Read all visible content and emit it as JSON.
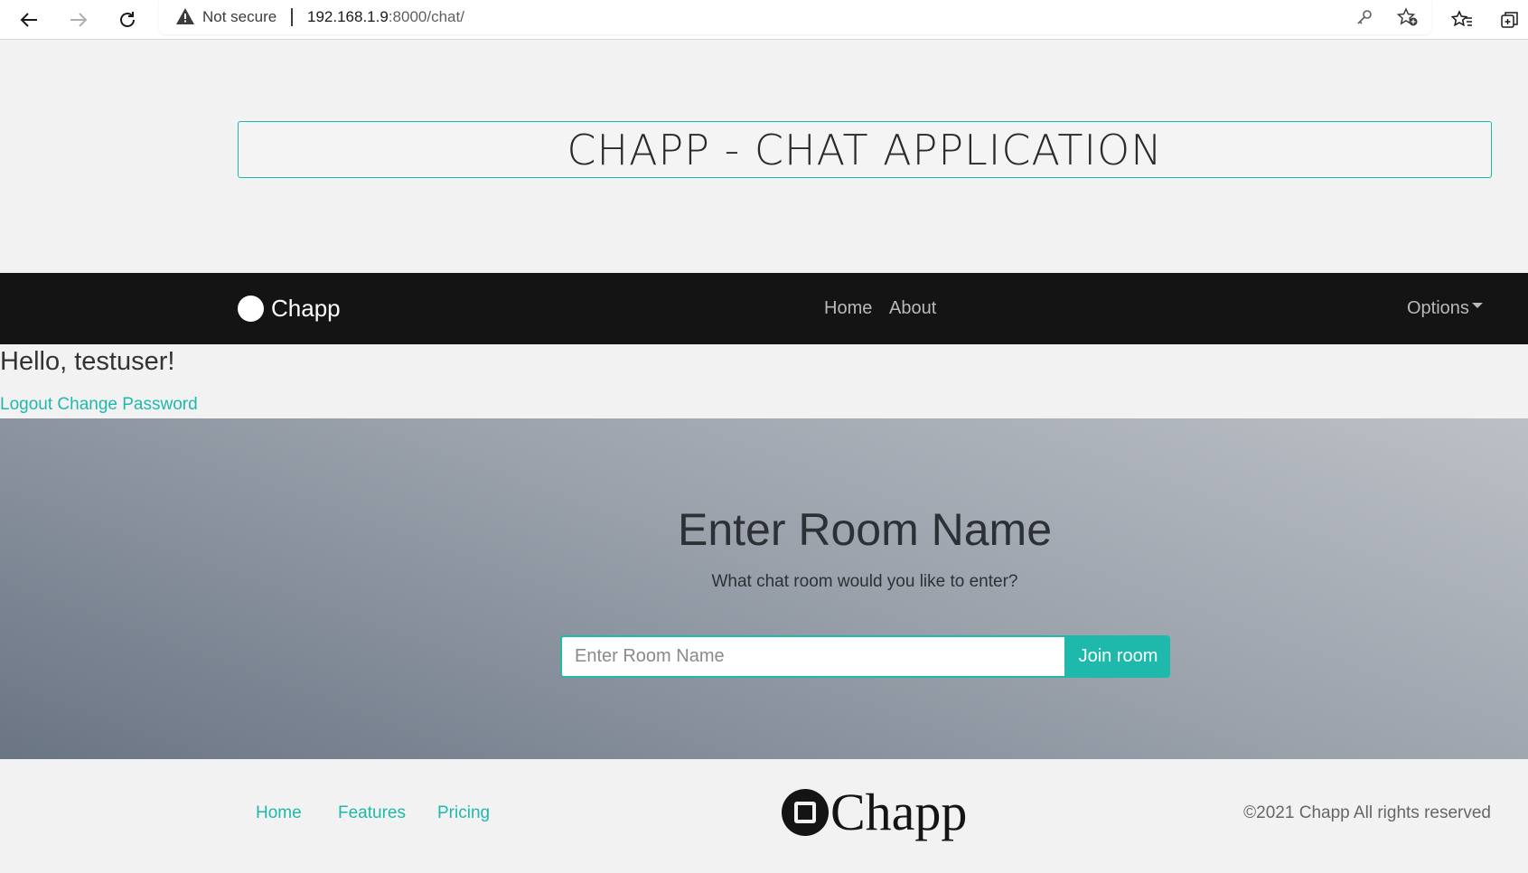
{
  "browser": {
    "security_label": "Not secure",
    "url_host": "192.168.1.9",
    "url_path": ":8000/chat/",
    "icons": [
      "back-arrow-icon",
      "forward-arrow-icon",
      "reload-icon",
      "warning-icon",
      "key-icon",
      "add-favorite-icon",
      "favorites-icon",
      "collections-icon"
    ]
  },
  "header": {
    "title": "CHAPP - CHAT APPLICATION"
  },
  "navbar": {
    "brand": "Chapp",
    "links": [
      {
        "label": "Home"
      },
      {
        "label": "About"
      }
    ],
    "options_label": "Options"
  },
  "user": {
    "greeting": "Hello, testuser!",
    "logout_label": "Logout",
    "change_password_label": "Change Password"
  },
  "hero": {
    "title": "Enter Room Name",
    "subtitle": "What chat room would you like to enter?",
    "input_placeholder": "Enter Room Name",
    "input_value": "",
    "button_label": "Join room"
  },
  "footer": {
    "links": [
      {
        "label": "Home"
      },
      {
        "label": "Features"
      },
      {
        "label": "Pricing"
      }
    ],
    "logo_text": "Chapp",
    "copyright": "©2021 Chapp All rights reserved"
  },
  "colors": {
    "accent": "#1fb9ab",
    "navbar_bg": "#141414",
    "page_bg": "#f2f2f2"
  }
}
